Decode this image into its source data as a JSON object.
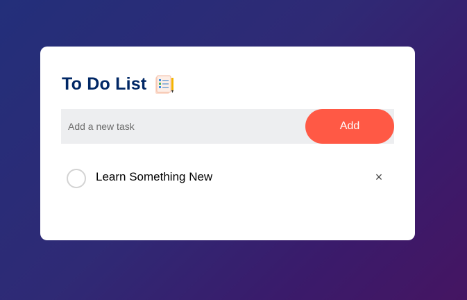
{
  "card": {
    "title": "To Do List",
    "title_icon": "notepad-checklist-icon"
  },
  "input": {
    "placeholder": "Add a new task",
    "value": ""
  },
  "add_button": {
    "label": "Add"
  },
  "tasks": [
    {
      "text": "Learn Something New",
      "checked": false,
      "delete_icon": "close-icon",
      "delete_glyph": "×"
    }
  ],
  "colors": {
    "title": "#002765",
    "accent": "#ff5945",
    "input_bg": "#edeef0",
    "background_start": "#232f7a",
    "background_end": "#451562"
  }
}
